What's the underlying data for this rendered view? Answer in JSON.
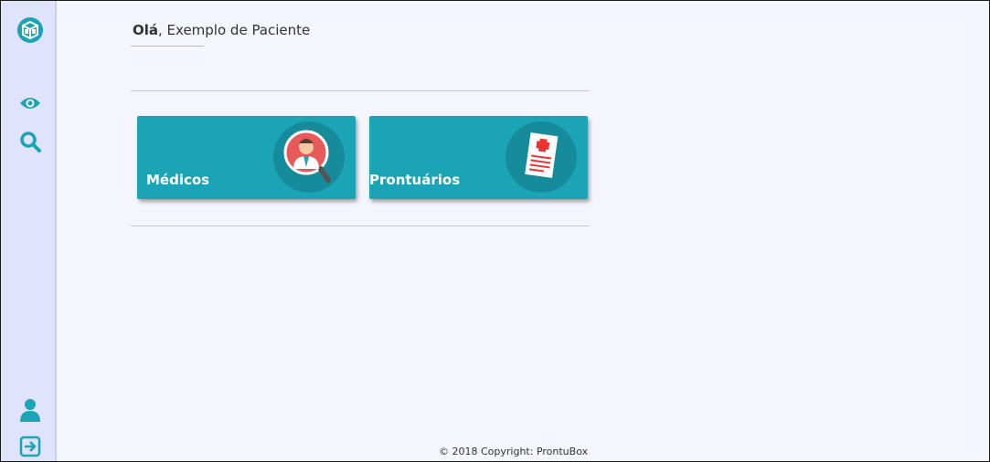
{
  "greeting": {
    "hello": "Olá",
    "name": ", Exemplo de Paciente"
  },
  "sidebar": {
    "logo_icon": "logo-box-icon",
    "items": [
      {
        "icon": "eye-icon"
      },
      {
        "icon": "search-icon"
      }
    ],
    "bottom": [
      {
        "icon": "user-icon"
      },
      {
        "icon": "logout-icon"
      }
    ]
  },
  "cards": [
    {
      "label": "Médicos",
      "icon": "doctor-icon"
    },
    {
      "label": "Prontuários",
      "icon": "medical-record-icon"
    }
  ],
  "footer": {
    "text": "© 2018 Copyright: ProntuBox"
  },
  "colors": {
    "accent": "#1ba3b6",
    "accent_dark": "#168b9c",
    "sidebar": "#dfe3fb",
    "background": "#f4f5fd"
  }
}
